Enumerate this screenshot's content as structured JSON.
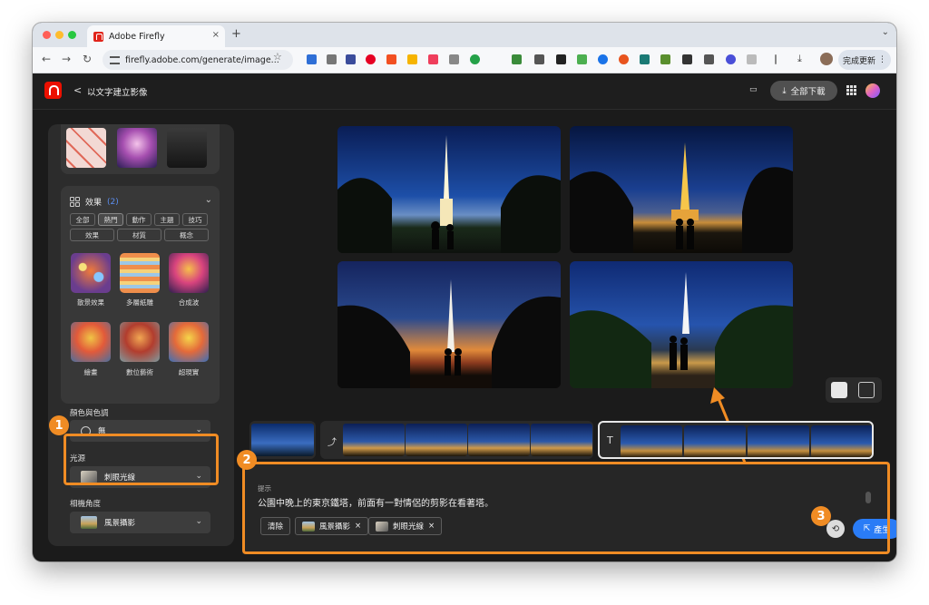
{
  "browser": {
    "tab_title": "Adobe Firefly",
    "tab_close": "×",
    "new_tab": "+",
    "tabs_menu": "⌄",
    "url": "firefly.adobe.com/generate/image...",
    "back": "←",
    "forward": "→",
    "reload": "↻",
    "bookmark": "☆",
    "finish_update": "完成更新",
    "finish_menu": "⋮"
  },
  "app": {
    "title": "以文字建立影像",
    "back": "<",
    "download_all": "全部下載",
    "download_icon": "⤓",
    "feedback_icon": "💬"
  },
  "sidebar": {
    "effects": {
      "title": "效果",
      "count": "(2)",
      "chevron": "⌄",
      "tabs_row1": [
        "全部",
        "熱門",
        "動作",
        "主題",
        "技巧"
      ],
      "tabs_row2": [
        "效果",
        "材質",
        "概念"
      ],
      "selected_tab": "熱門",
      "tiles": [
        "散景效果",
        "多層紙雕",
        "合成波",
        "繪畫",
        "數位藝術",
        "超現實"
      ]
    },
    "color_tone": {
      "label": "顏色與色調",
      "value": "無"
    },
    "lighting": {
      "label": "光源",
      "value": "刺眼光線"
    },
    "camera_angle": {
      "label": "相機角度",
      "value": "風景攝影"
    },
    "dropdown_chevron": "⌄"
  },
  "prompt": {
    "label": "提示",
    "text": "公園中晚上的東京鐵塔，前面有一對情侶的剪影在看著塔。",
    "clear": "清除",
    "tags": [
      "風景攝影",
      "刺眼光線"
    ],
    "tag_remove": "×",
    "generate": "產生",
    "history_icon": "⟲"
  },
  "annotations": [
    "1",
    "2",
    "3"
  ],
  "colors": {
    "accent_blue": "#2a7cf6",
    "annotation_orange": "#f08c24",
    "adobe_red": "#eb1000"
  }
}
